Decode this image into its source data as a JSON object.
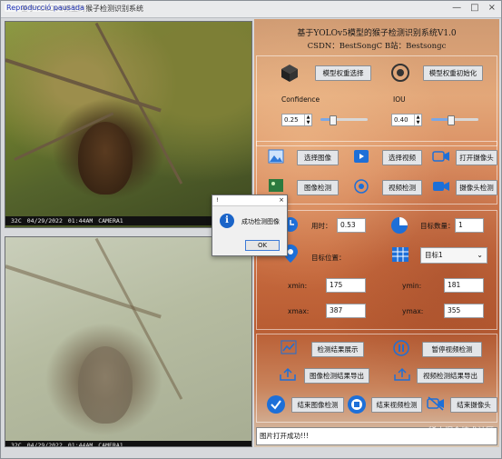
{
  "window": {
    "overlay_tag": "Reproducció pausada",
    "title": "基于YOLOv5模型的猴子检测识别系统"
  },
  "camera": {
    "temp": "32C",
    "date": "04/29/2022",
    "time": "01:44AM",
    "cam": "CAMERA1"
  },
  "header": {
    "title": "基于YOLOv5模型的猴子检测识别系统V1.0",
    "subtitle": "CSDN：BestSongC   B站：Bestsongc"
  },
  "model": {
    "select_label": "模型权重选择",
    "init_label": "模型权重初始化",
    "confidence_label": "Confidence",
    "iou_label": "IOU",
    "confidence_value": "0.25",
    "iou_value": "0.40",
    "confidence_level": 0.25,
    "iou_level": 0.4
  },
  "actions": {
    "select_image": "选择图像",
    "select_video": "选择视频",
    "open_camera": "打开摄像头",
    "image_detect": "图像检测",
    "video_detect": "视频检测",
    "camera_detect": "摄像头检测"
  },
  "results": {
    "time_label": "用时：",
    "time_value": "0.53",
    "count_label": "目标数量：",
    "count_value": "1",
    "position_label": "目标位置：",
    "target_select": "目标1",
    "xmin_label": "xmin:",
    "xmin_value": "175",
    "ymin_label": "ymin:",
    "ymin_value": "181",
    "xmax_label": "xmax:",
    "xmax_value": "387",
    "ymax_label": "ymax:",
    "ymax_value": "355"
  },
  "controls": {
    "show_results": "检测结果展示",
    "pause_video": "暂停视频检测",
    "export_image": "图像检测结果导出",
    "export_video": "视频检测结果导出",
    "end_image": "结束图像检测",
    "end_video": "结束视频检测",
    "end_camera": "结束摄像头"
  },
  "status": {
    "text": "图片打开成功!!!"
  },
  "watermark": "@稀土掘金技术社区",
  "dialog": {
    "title": "!",
    "message": "成功检测图像",
    "ok": "OK"
  },
  "colors": {
    "accent": "#1a64c8",
    "panel_orange": "#d7865a"
  }
}
